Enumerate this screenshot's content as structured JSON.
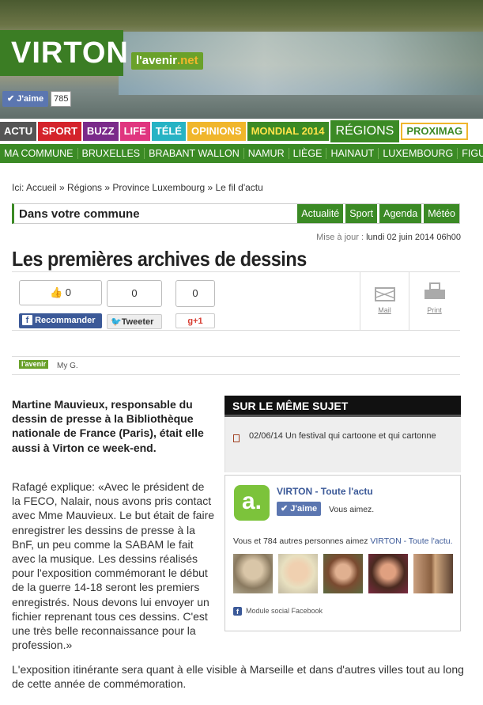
{
  "header": {
    "city": "VIRTON",
    "brand_main": "l'avenir",
    "brand_suffix": ".net",
    "like_label": "J'aime",
    "like_count": "785"
  },
  "nav_primary": [
    {
      "label": "ACTU",
      "color": "#555555"
    },
    {
      "label": "SPORT",
      "color": "#d4232b"
    },
    {
      "label": "BUZZ",
      "color": "#7a2a8a"
    },
    {
      "label": "LIFE",
      "color": "#e0357f"
    },
    {
      "label": "TÉLÉ",
      "color": "#27b3c4"
    },
    {
      "label": "OPINIONS",
      "color": "#f0b62c"
    },
    {
      "label": "MONDIAL 2014",
      "color": "#3b8a25",
      "text_color": "#ffe34a"
    },
    {
      "label": "RÉGIONS",
      "color": "#3b8a25"
    },
    {
      "label": "PROXIMAG",
      "color": "#ffffff",
      "text_color": "#3b8a25"
    }
  ],
  "nav_regions": [
    "MA COMMUNE",
    "BRUXELLES",
    "BRABANT WALLON",
    "NAMUR",
    "LIÈGE",
    "HAINAUT",
    "LUXEMBOURG",
    "FIGURES LI"
  ],
  "breadcrumb": "Ici: Accueil » Régions » Province Luxembourg » Le fil d'actu",
  "commune": {
    "title": "Dans votre commune",
    "tabs": [
      {
        "label": "Actualité",
        "color": "#3b8a25"
      },
      {
        "label": "Sport",
        "color": "#3b8a25"
      },
      {
        "label": "Agenda",
        "color": "#3b8a25"
      },
      {
        "label": "Météo",
        "color": "#3b8a25"
      }
    ]
  },
  "updated_label": "Mise à jour :",
  "updated_value": "lundi 02 juin 2014 06h00",
  "article": {
    "title": "Les premières archives de dessins",
    "source_tag": "l'avenir",
    "author": "My G.",
    "lead": "Martine Mauvieux, responsable du dessin de presse à la Bibliothèque nationale de France (Paris), était elle aussi à Virton ce week-end.",
    "body_1": "Rafagé explique: «Avec le président de la FECO, Nalair, nous avons pris contact avec Mme Mauvieux. Le but était de faire enregistrer les dessins de presse à la BnF, un peu comme la SABAM le fait avec la musique. Les dessins réalisés pour l'exposition commémorant le début de la guerre 14-18 seront les premiers enregistrés. Nous devons lui envoyer un fichier reprenant tous ces dessins. C'est une très belle reconnaissance pour la profession.»",
    "body_2": "L'exposition itinérante sera quant à elle visible à Marseille et dans d'autres villes tout au long de cette année de commémoration."
  },
  "share": {
    "fb_count": "0",
    "fb_label": "Recommander",
    "tw_count": "0",
    "tw_label": "Tweeter",
    "gp_count": "0",
    "gp_label": "+1",
    "mail_label": "Mail",
    "print_label": "Print"
  },
  "sidebar": {
    "heading": "SUR LE MÊME SUJET",
    "related": "02/06/14 Un festival qui cartoone et qui cartonne"
  },
  "facebook_box": {
    "logo_letter": "a.",
    "page_name": "VIRTON - Toute l'actu",
    "like_label": "J'aime",
    "you_like": "Vous aimez.",
    "others_prefix": "Vous et 784 autres personnes aimez",
    "others_page": "VIRTON - Toute l'actu.",
    "module_label": "Module social Facebook"
  }
}
